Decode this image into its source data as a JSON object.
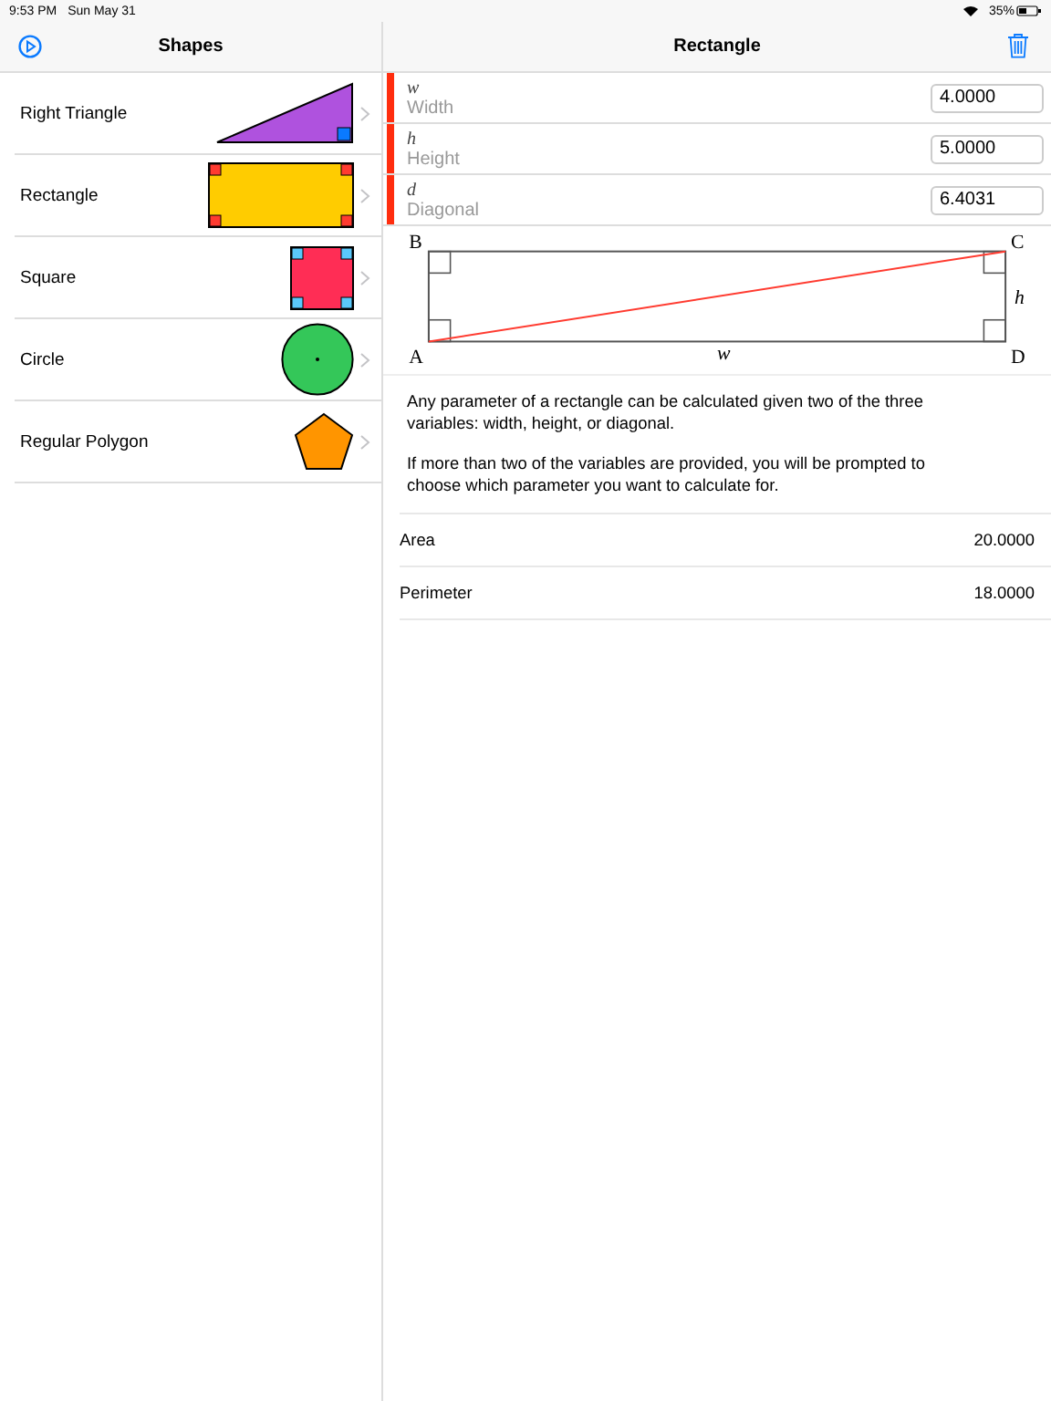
{
  "status_bar": {
    "time": "9:53 PM",
    "date": "Sun May 31",
    "battery": "35%"
  },
  "sidebar": {
    "title": "Shapes",
    "items": [
      {
        "label": "Right Triangle",
        "kind": "triangle",
        "selected": false
      },
      {
        "label": "Rectangle",
        "kind": "rectangle",
        "selected": false
      },
      {
        "label": "Square",
        "kind": "square",
        "selected": false
      },
      {
        "label": "Circle",
        "kind": "circle",
        "selected": false
      },
      {
        "label": "Regular Polygon",
        "kind": "polygon",
        "selected": false
      }
    ]
  },
  "detail": {
    "title": "Rectangle",
    "parameters": [
      {
        "symbol": "w",
        "label": "Width",
        "value": "4.0000"
      },
      {
        "symbol": "h",
        "label": "Height",
        "value": "5.0000"
      },
      {
        "symbol": "d",
        "label": "Diagonal",
        "value": "6.4031"
      }
    ],
    "diagram": {
      "corner_b": "B",
      "corner_c": "C",
      "corner_a": "A",
      "corner_d": "D",
      "width_label": "w",
      "height_label": "h"
    },
    "description": [
      "Any parameter of a rectangle can be calculated given two of the three variables: width, height, or diagonal.",
      "If more than two of the variables are provided, you will be prompted to choose which parameter you want to calculate for."
    ],
    "results": [
      {
        "label": "Area",
        "value": "20.0000"
      },
      {
        "label": "Perimeter",
        "value": "18.0000"
      }
    ]
  }
}
